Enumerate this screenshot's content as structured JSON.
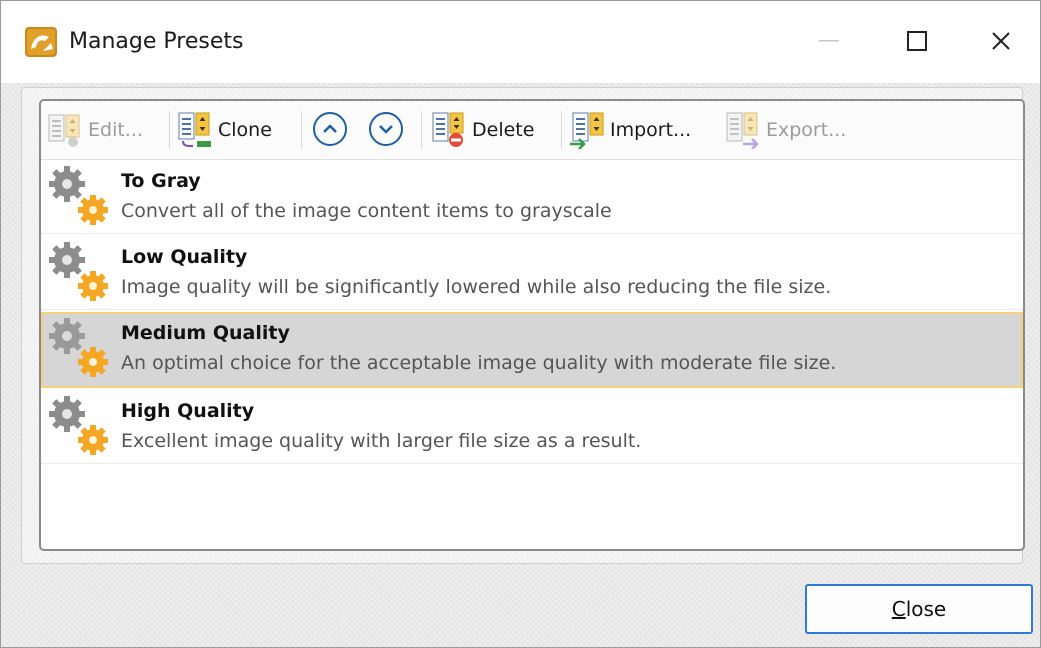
{
  "window": {
    "title": "Manage Presets",
    "controls": {
      "minimize": "—",
      "maximize": "□",
      "close": "✕"
    }
  },
  "toolbar": {
    "edit_label": "Edit...",
    "clone_label": "Clone",
    "move_up_icon": "chevron-up-icon",
    "move_down_icon": "chevron-down-icon",
    "delete_label": "Delete",
    "import_label": "Import...",
    "export_label": "Export...",
    "disabled": [
      "Edit...",
      "Export..."
    ]
  },
  "presets": [
    {
      "title": "To Gray",
      "description": "Convert all of the image content items to grayscale",
      "selected": false
    },
    {
      "title": "Low Quality",
      "description": "Image quality will be significantly lowered while also reducing the file size.",
      "selected": false
    },
    {
      "title": "Medium Quality",
      "description": "An optimal choice for the acceptable image quality with moderate file size.",
      "selected": true
    },
    {
      "title": "High Quality",
      "description": "Excellent image quality with larger file size as a result.",
      "selected": false
    }
  ],
  "footer": {
    "close_mnemonic": "C",
    "close_rest": "lose"
  },
  "colors": {
    "accent": "#2f7bd6",
    "selection": "#d6d6d6",
    "selection_border": "#f3d27a",
    "gear_orange": "#f5a623",
    "gear_gray": "#8c8c8c"
  }
}
